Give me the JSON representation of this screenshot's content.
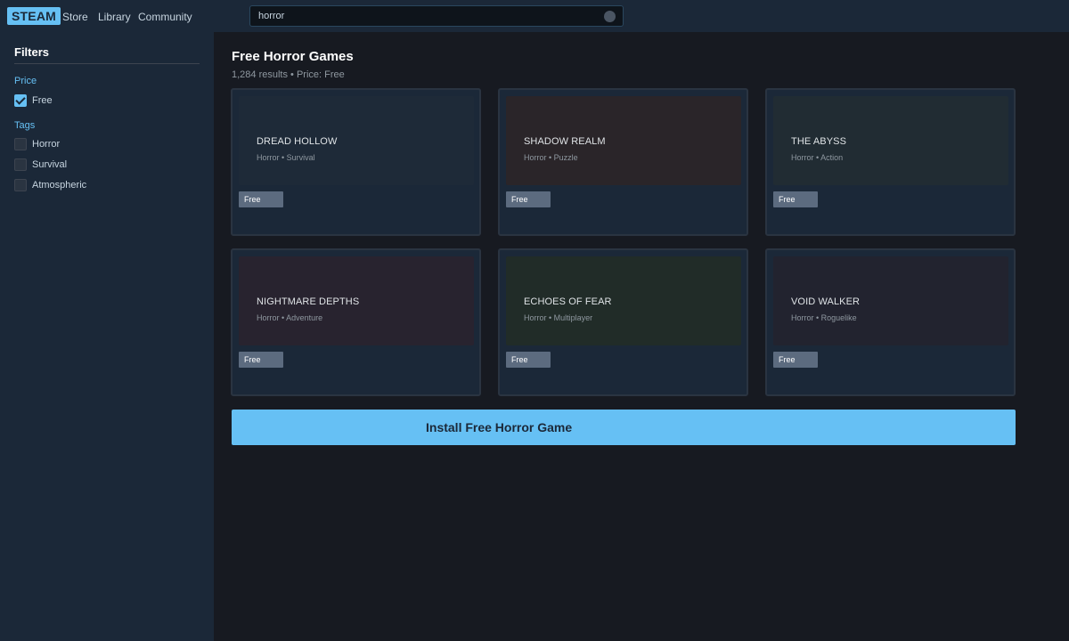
{
  "topbar": {
    "logo": "STEAM",
    "nav": [
      "Store",
      "Library",
      "Community"
    ],
    "search_value": "horror",
    "search_icon": "search-icon"
  },
  "sidebar": {
    "title": "Filters",
    "price_section": "Price",
    "price_options": [
      {
        "label": "Free",
        "checked": true
      }
    ],
    "tags_section": "Tags",
    "tag_options": [
      {
        "label": "Horror",
        "checked": false
      },
      {
        "label": "Survival",
        "checked": false
      },
      {
        "label": "Atmospheric",
        "checked": false
      }
    ]
  },
  "main": {
    "title": "Free Horror Games",
    "subtitle": "1,284 results • Price: Free",
    "games": [
      {
        "name": "DREAD HOLLOW",
        "tags": "Horror • Survival",
        "price": "Free",
        "color": "#1e2a38"
      },
      {
        "name": "SHADOW REALM",
        "tags": "Horror • Puzzle",
        "price": "Free",
        "color": "#2a2529"
      },
      {
        "name": "THE ABYSS",
        "tags": "Horror • Action",
        "price": "Free",
        "color": "#212c33"
      },
      {
        "name": "NIGHTMARE DEPTHS",
        "tags": "Horror • Adventure",
        "price": "Free",
        "color": "#28232f"
      },
      {
        "name": "ECHOES OF FEAR",
        "tags": "Horror • Multiplayer",
        "price": "Free",
        "color": "#212c28"
      },
      {
        "name": "VOID WALKER",
        "tags": "Horror • Roguelike",
        "price": "Free",
        "color": "#22232f"
      }
    ],
    "install_label": "Install Free Horror Game"
  },
  "colors": {
    "accent": "#66c0f4",
    "panel": "#1b2838",
    "background": "#171a21"
  }
}
